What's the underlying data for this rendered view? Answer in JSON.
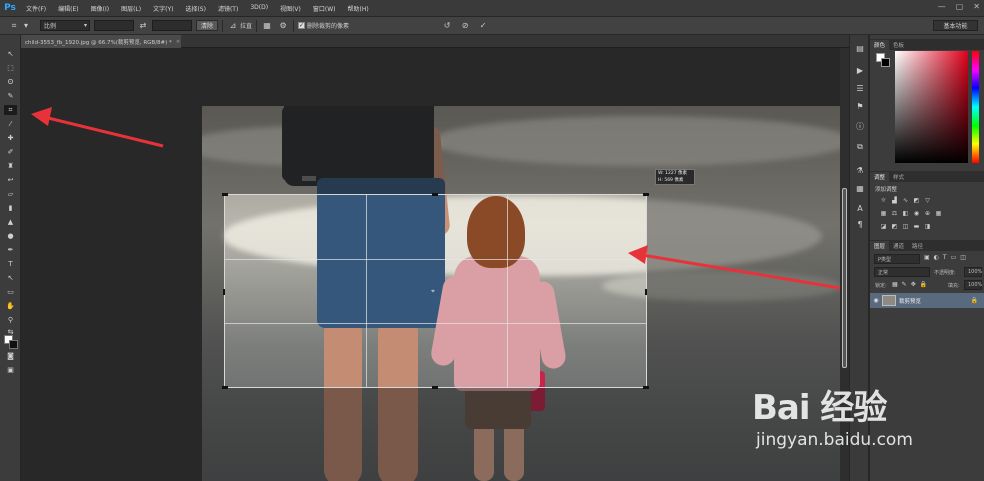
{
  "app": {
    "logo": "Ps",
    "menu": [
      "文件(F)",
      "编辑(E)",
      "图像(I)",
      "图层(L)",
      "文字(Y)",
      "选择(S)",
      "滤镜(T)",
      "3D(D)",
      "视图(V)",
      "窗口(W)",
      "帮助(H)"
    ],
    "window_controls": [
      "—",
      "▢",
      "✕"
    ]
  },
  "options": {
    "ratio_select": "比例",
    "straighten_label": "拉直",
    "delete_pixels_label": "删除裁剪的像素",
    "delete_pixels_checked": true,
    "workspace": "基本功能"
  },
  "document": {
    "tab_title": "child-3553_fb_1920.jpg @ 66.7%(裁剪预览, RGB/8#) *",
    "tab_close": "×"
  },
  "crop": {
    "size_w": "W: 1227 像素",
    "size_h": "H:  569 像素"
  },
  "panels": {
    "color_tabs": [
      "颜色",
      "色板"
    ],
    "adjust_tabs": [
      "调整",
      "样式"
    ],
    "adjust_title": "添加调整",
    "layers_tabs": [
      "图层",
      "通道",
      "路径"
    ],
    "kind_filter": "P类型",
    "blend_mode": "正常",
    "opacity_label": "不透明度:",
    "opacity_value": "100%",
    "lock_label": "锁定:",
    "fill_label": "填充:",
    "fill_value": "100%",
    "layer_name": "裁剪预览"
  },
  "watermark": {
    "brand": "Bai  经验",
    "url": "jingyan.baidu.com"
  },
  "colors": {
    "annotation_red": "#e8323a",
    "ps_blue": "#31a8ff",
    "layer_selected": "#596a7e"
  }
}
